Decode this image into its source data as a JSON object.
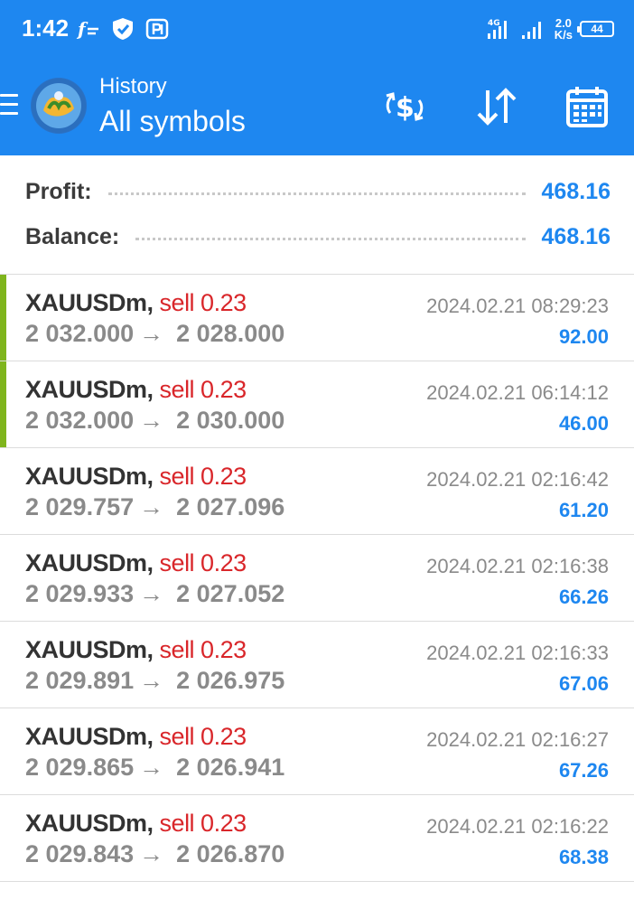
{
  "status_bar": {
    "time": "1:42",
    "network": "4G",
    "net_speed_value": "2.0",
    "net_speed_unit": "K/s",
    "battery": "44"
  },
  "app_bar": {
    "title": "History",
    "subtitle": "All symbols"
  },
  "summary": {
    "profit_label": "Profit:",
    "profit_value": "468.16",
    "balance_label": "Balance:",
    "balance_value": "468.16"
  },
  "colors": {
    "accent": "#1e87f0",
    "sell": "#d9262a",
    "indicator": "#7fb51d"
  },
  "trades": [
    {
      "symbol": "XAUUSDm,",
      "type": "sell 0.23",
      "open": "2 032.000",
      "close": "2 028.000",
      "time": "2024.02.21 08:29:23",
      "profit": "92.00",
      "highlight": true
    },
    {
      "symbol": "XAUUSDm,",
      "type": "sell 0.23",
      "open": "2 032.000",
      "close": "2 030.000",
      "time": "2024.02.21 06:14:12",
      "profit": "46.00",
      "highlight": true
    },
    {
      "symbol": "XAUUSDm,",
      "type": "sell 0.23",
      "open": "2 029.757",
      "close": "2 027.096",
      "time": "2024.02.21 02:16:42",
      "profit": "61.20",
      "highlight": false
    },
    {
      "symbol": "XAUUSDm,",
      "type": "sell 0.23",
      "open": "2 029.933",
      "close": "2 027.052",
      "time": "2024.02.21 02:16:38",
      "profit": "66.26",
      "highlight": false
    },
    {
      "symbol": "XAUUSDm,",
      "type": "sell 0.23",
      "open": "2 029.891",
      "close": "2 026.975",
      "time": "2024.02.21 02:16:33",
      "profit": "67.06",
      "highlight": false
    },
    {
      "symbol": "XAUUSDm,",
      "type": "sell 0.23",
      "open": "2 029.865",
      "close": "2 026.941",
      "time": "2024.02.21 02:16:27",
      "profit": "67.26",
      "highlight": false
    },
    {
      "symbol": "XAUUSDm,",
      "type": "sell 0.23",
      "open": "2 029.843",
      "close": "2 026.870",
      "time": "2024.02.21 02:16:22",
      "profit": "68.38",
      "highlight": false
    }
  ]
}
